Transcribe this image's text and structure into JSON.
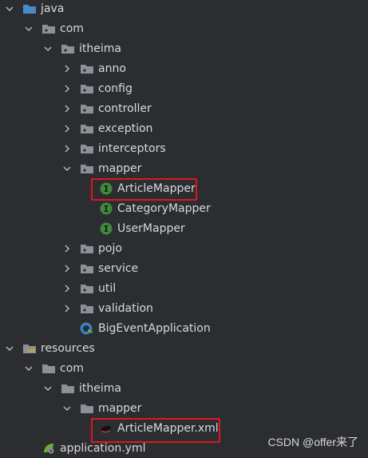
{
  "tree": {
    "items": [
      {
        "label": "java",
        "icon": "source-folder-icon",
        "arrow": "down",
        "level": 0
      },
      {
        "label": "com",
        "icon": "package-icon",
        "arrow": "down",
        "level": 1
      },
      {
        "label": "itheima",
        "icon": "package-icon",
        "arrow": "down",
        "level": 2
      },
      {
        "label": "anno",
        "icon": "package-icon",
        "arrow": "right",
        "level": 3
      },
      {
        "label": "config",
        "icon": "package-icon",
        "arrow": "right",
        "level": 3
      },
      {
        "label": "controller",
        "icon": "package-icon",
        "arrow": "right",
        "level": 3
      },
      {
        "label": "exception",
        "icon": "package-icon",
        "arrow": "right",
        "level": 3
      },
      {
        "label": "interceptors",
        "icon": "package-icon",
        "arrow": "right",
        "level": 3
      },
      {
        "label": "mapper",
        "icon": "package-icon",
        "arrow": "down",
        "level": 3
      },
      {
        "label": "ArticleMapper",
        "icon": "interface-icon",
        "arrow": "none",
        "level": 4
      },
      {
        "label": "CategoryMapper",
        "icon": "interface-icon",
        "arrow": "none",
        "level": 4
      },
      {
        "label": "UserMapper",
        "icon": "interface-icon",
        "arrow": "none",
        "level": 4
      },
      {
        "label": "pojo",
        "icon": "package-icon",
        "arrow": "right",
        "level": 3
      },
      {
        "label": "service",
        "icon": "package-icon",
        "arrow": "right",
        "level": 3
      },
      {
        "label": "util",
        "icon": "package-icon",
        "arrow": "right",
        "level": 3
      },
      {
        "label": "validation",
        "icon": "package-icon",
        "arrow": "right",
        "level": 3
      },
      {
        "label": "BigEventApplication",
        "icon": "spring-boot-class-icon",
        "arrow": "none",
        "level": 3
      },
      {
        "label": "resources",
        "icon": "resources-folder-icon",
        "arrow": "down",
        "level": 0
      },
      {
        "label": "com",
        "icon": "folder-icon",
        "arrow": "down",
        "level": 1
      },
      {
        "label": "itheima",
        "icon": "folder-icon",
        "arrow": "down",
        "level": 2
      },
      {
        "label": "mapper",
        "icon": "folder-icon",
        "arrow": "down",
        "level": 3
      },
      {
        "label": "ArticleMapper.xml",
        "icon": "mybatis-xml-icon",
        "arrow": "none",
        "level": 4
      },
      {
        "label": "application.yml",
        "icon": "spring-yml-icon",
        "arrow": "none",
        "level": 1
      }
    ],
    "highlighted": [
      "ArticleMapper",
      "ArticleMapper.xml"
    ]
  },
  "watermark": "CSDN @offer来了",
  "colors": {
    "background": "#2b2d30",
    "highlight_border": "#e0151f",
    "interface_icon": "#3f8a3b",
    "folder_icon": "#8c9099",
    "source_folder_icon": "#4a8ac8"
  }
}
